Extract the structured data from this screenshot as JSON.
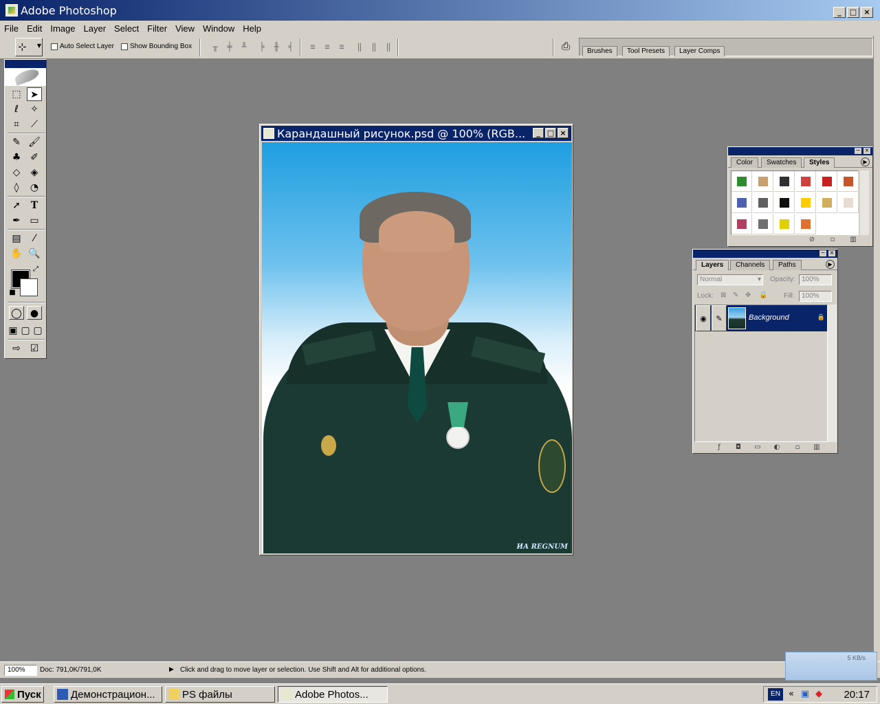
{
  "app": {
    "title": "Adobe Photoshop"
  },
  "menu": [
    "File",
    "Edit",
    "Image",
    "Layer",
    "Select",
    "Filter",
    "View",
    "Window",
    "Help"
  ],
  "options": {
    "auto_select": "Auto Select Layer",
    "bounding_box": "Show Bounding Box"
  },
  "palette_well": {
    "tabs": [
      "Brushes",
      "Tool Presets",
      "Layer Comps"
    ]
  },
  "document": {
    "title": "Карандашный рисунок.psd @ 100% (RGB...",
    "watermark": "ИА REGNUM"
  },
  "styles_palette": {
    "tabs": [
      "Color",
      "Swatches",
      "Styles"
    ],
    "active_tab": "Styles",
    "swatches": [
      [
        "#2e8b2e",
        "#c8a070",
        "#303030",
        "#d04040",
        "#c82020",
        "#c8552a"
      ],
      [
        "#5060b0",
        "#606060",
        "#101010",
        "#ffcc00",
        "#d0b060",
        "#e8dcd0"
      ],
      [
        "#b04060",
        "#707070",
        "#e0d000",
        "#e07030"
      ]
    ]
  },
  "layers_palette": {
    "tabs": [
      "Layers",
      "Channels",
      "Paths"
    ],
    "blend_mode": "Normal",
    "opacity_label": "Opacity:",
    "opacity_value": "100%",
    "lock_label": "Lock:",
    "fill_label": "Fill:",
    "fill_value": "100%",
    "layer_name": "Background"
  },
  "status": {
    "zoom": "100%",
    "doc_info": "Doc: 791,0K/791,0K",
    "message": "Click and drag to move layer or selection.  Use Shift and Alt for additional options."
  },
  "net_widget": {
    "rate": "5 KB/s"
  },
  "taskbar": {
    "start": "Пуск",
    "tasks": [
      "Демонстрацион...",
      "PS файлы",
      "Adobe Photos..."
    ],
    "lang": "EN",
    "clock": "20:17"
  }
}
